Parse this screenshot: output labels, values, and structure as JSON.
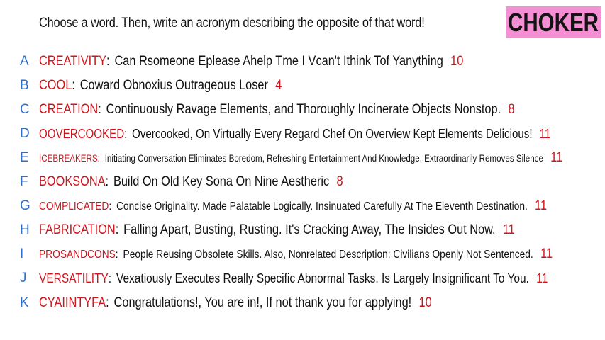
{
  "header": {
    "prompt": "Choose a word. Then, write an acronym describing the opposite of that word!",
    "brand": "CHOKER"
  },
  "rows": [
    {
      "letter": "A",
      "word": "CREATIVITY",
      "phrase": "Can Rsomeone Eplease Ahelp Tme I Vcan't Ithink Tof Yanything",
      "score": "10"
    },
    {
      "letter": "B",
      "word": "COOL",
      "phrase": "Coward Obnoxius Outrageous Loser",
      "score": "4"
    },
    {
      "letter": "C",
      "word": "CREATION",
      "phrase": "Continuously Ravage Elements, and Thoroughly Incinerate Objects Nonstop.",
      "score": "8"
    },
    {
      "letter": "D",
      "word": "OOVERCOOKED",
      "phrase": "Overcooked, On Virtually Every Regard Chef On Overview Kept Elements Delicious!",
      "score": "11"
    },
    {
      "letter": "E",
      "word": "ICEBREAKERS",
      "phrase": "Initiating Conversation Eliminates Boredom, Refreshing Entertainment And Knowledge, Extraordinarily Removes Silence",
      "score": "11"
    },
    {
      "letter": "F",
      "word": "BOOKSONA",
      "phrase": "Build On Old Key Sona On Nine Aestheric",
      "score": "8"
    },
    {
      "letter": "G",
      "word": "COMPLICATED",
      "phrase": "Concise Originality. Made Palatable Logically. Insinuated Carefully At The Eleventh Destination.",
      "score": "11"
    },
    {
      "letter": "H",
      "word": "FABRICATION",
      "phrase": "Falling Apart, Busting, Rusting. It's Cracking Away, The Insides Out Now.",
      "score": "11"
    },
    {
      "letter": "I",
      "word": "PROSANDCONS",
      "phrase": "People Reusing Obsolete Skills. Also, Nonrelated Description: Civilians Openly Not Sentenced.",
      "score": "11"
    },
    {
      "letter": "J",
      "word": "VERSATILITY",
      "phrase": "Vexatiously Executes Really Specific Abnormal Tasks. Is Largely Insignificant To You.",
      "score": "11"
    },
    {
      "letter": "K",
      "word": "CYAIINTYFA",
      "phrase": "Congratulations!, You are in!, If not thank you for applying!",
      "score": "10"
    }
  ],
  "colors": {
    "letter": "#2b6fce",
    "word": "#d0141c",
    "score": "#d0141c",
    "brand_bg": "#f58fd3"
  }
}
